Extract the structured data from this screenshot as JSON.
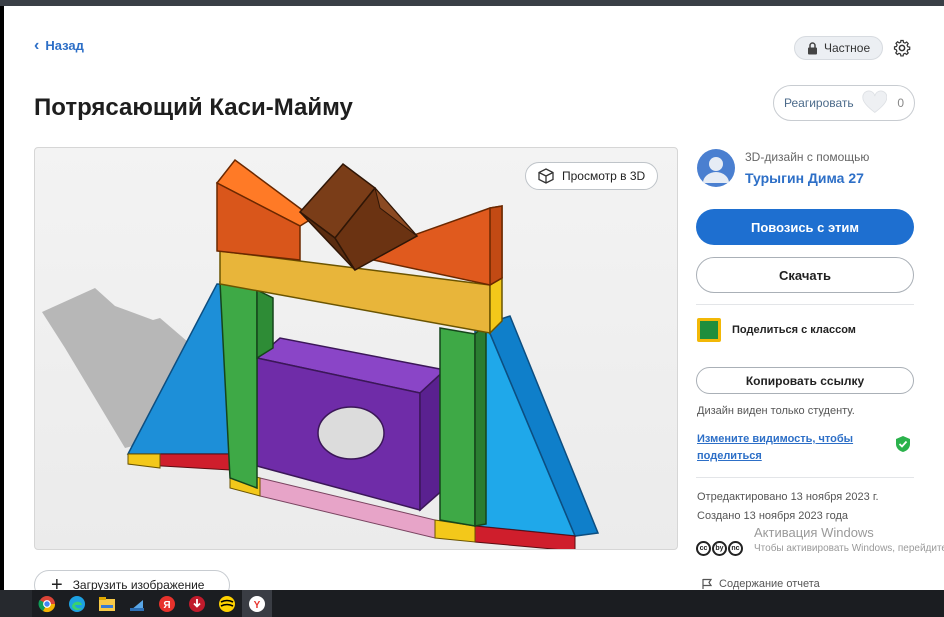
{
  "nav": {
    "back_label": "Назад"
  },
  "privacy": {
    "label": "Частное"
  },
  "design": {
    "title": "Потрясающий Каси-Майму",
    "react_label": "Реагировать",
    "react_count": "0",
    "view3d_label": "Просмотр в 3D",
    "upload_label": "Загрузить изображение"
  },
  "author": {
    "subtitle": "3D-дизайн с помощью",
    "name": "Турыгин Дима 27"
  },
  "actions": {
    "tinker_label": "Повозись с этим",
    "download_label": "Скачать",
    "share_class_label": "Поделиться с классом",
    "copy_link_label": "Копировать ссылку"
  },
  "visibility": {
    "note": "Дизайн виден только студенту.",
    "change_link": "Измените видимость, чтобы поделиться"
  },
  "meta": {
    "edited": "Отредактировано 13 ноября 2023 г.",
    "created": "Создано 13 ноября 2023 года",
    "license_icons": [
      "cc",
      "by",
      "nc"
    ]
  },
  "report": {
    "label": "Содержание отчета"
  },
  "watermark": {
    "title": "Активация Windows",
    "subtitle": "Чтобы активировать Windows, перейдите"
  },
  "taskbar": {
    "icons": [
      "chrome-icon",
      "edge-icon",
      "file-explorer-icon",
      "store-icon",
      "yandex-icon",
      "download-icon",
      "beeline-icon",
      "yandex-browser-icon"
    ]
  },
  "colors": {
    "accent": "#1e6fd0",
    "link": "#2d6fc7"
  }
}
